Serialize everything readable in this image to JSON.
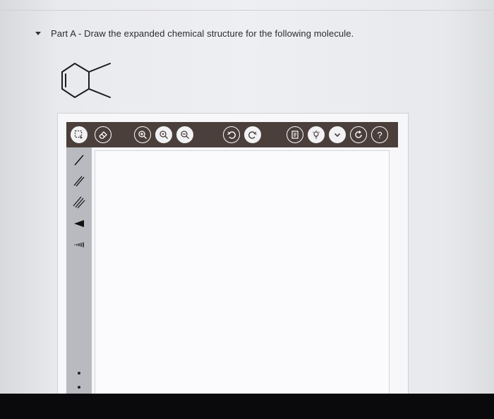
{
  "part": {
    "title": "Part A - Draw the expanded chemical structure for the following molecule."
  },
  "molecule": {
    "icon": "methylcyclohexene-skeletal-structure-icon"
  },
  "toolbar": {
    "buttons": [
      {
        "name": "select-tool-button",
        "icon": "marquee-select-icon"
      },
      {
        "name": "erase-tool-button",
        "icon": "eraser-icon"
      },
      {
        "name": "zoom-in-button",
        "icon": "zoom-in-icon"
      },
      {
        "name": "zoom-reset-button",
        "icon": "zoom-fit-icon"
      },
      {
        "name": "zoom-out-button",
        "icon": "zoom-out-icon"
      },
      {
        "name": "undo-button",
        "icon": "undo-icon"
      },
      {
        "name": "redo-button",
        "icon": "redo-icon"
      },
      {
        "name": "template-button",
        "icon": "document-icon"
      },
      {
        "name": "hint-button",
        "icon": "lightbulb-icon"
      },
      {
        "name": "more-button",
        "icon": "chevron-down-icon"
      },
      {
        "name": "reset-button",
        "icon": "reset-icon"
      },
      {
        "name": "help-button",
        "label": "?",
        "icon": "question-icon"
      }
    ]
  },
  "side_tools": [
    {
      "name": "single-bond-tool",
      "icon": "single-bond-icon"
    },
    {
      "name": "double-bond-tool",
      "icon": "double-bond-icon"
    },
    {
      "name": "triple-bond-tool",
      "icon": "triple-bond-icon"
    },
    {
      "name": "wedge-bond-tool",
      "icon": "wedge-bond-icon"
    },
    {
      "name": "hash-bond-tool",
      "icon": "hash-bond-icon"
    }
  ],
  "colors": {
    "toolbar_bg": "#4a3f3a",
    "strip_bg": "#b8babf",
    "canvas_bg": "#fbfbfd"
  }
}
